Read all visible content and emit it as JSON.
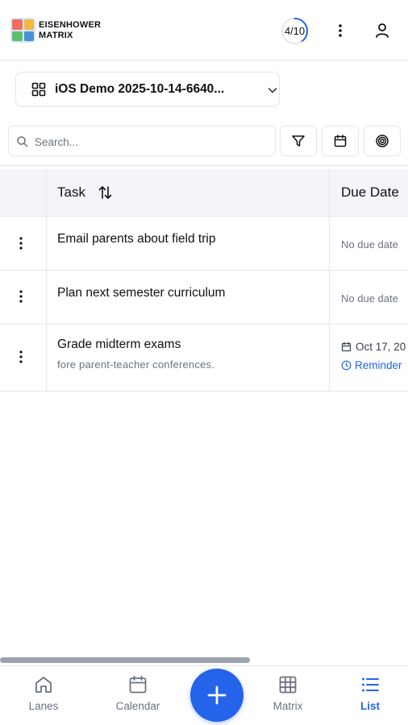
{
  "header": {
    "brand_line1": "EISENHOWER",
    "brand_line2": "MATRIX",
    "progress_text": "4/10",
    "progress_value": 0.4,
    "logo_colors": [
      "#f26d5b",
      "#f5b942",
      "#5bc06b",
      "#4a90d9"
    ]
  },
  "project": {
    "name": "iOS Demo 2025-10-14-6640..."
  },
  "search": {
    "placeholder": "Search..."
  },
  "table": {
    "headers": {
      "task": "Task",
      "due": "Due Date"
    },
    "rows": [
      {
        "title": "Email parents about field trip",
        "subtitle": "",
        "due": "No due date",
        "reminder": ""
      },
      {
        "title": "Plan next semester curriculum",
        "subtitle": "",
        "due": "No due date",
        "reminder": ""
      },
      {
        "title": "Grade midterm exams",
        "subtitle": "fore parent-teacher conferences.",
        "due": "Oct 17, 20",
        "reminder": "Reminder"
      }
    ]
  },
  "nav": {
    "items": [
      {
        "label": "Lanes",
        "icon": "home-icon"
      },
      {
        "label": "Calendar",
        "icon": "calendar-icon"
      },
      {
        "label": "Matrix",
        "icon": "grid-icon"
      },
      {
        "label": "List",
        "icon": "list-icon"
      }
    ],
    "active": "List",
    "add_icon": "plus-icon"
  },
  "colors": {
    "accent": "#2563eb",
    "text": "#111111",
    "muted": "#6b7280",
    "border": "#e5e7eb"
  }
}
